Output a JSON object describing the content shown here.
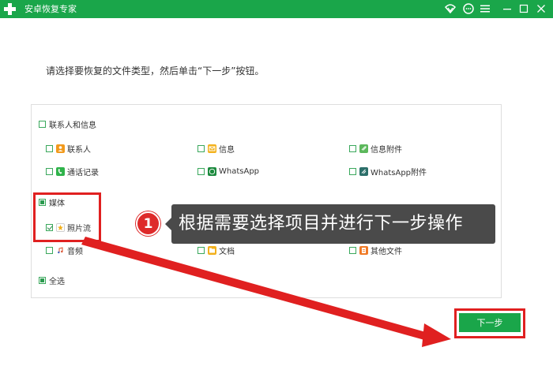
{
  "window": {
    "title": "安卓恢复专家",
    "icons": [
      "plus-logo-icon",
      "wifi-icon",
      "chat-icon",
      "menu-icon",
      "minimize-icon",
      "maximize-icon",
      "close-icon"
    ]
  },
  "instruction": "请选择要恢复的文件类型，然后单击“下一步”按钮。",
  "groups": {
    "contacts": {
      "label": "联系人和信息",
      "items": {
        "contacts": "联系人",
        "messages": "信息",
        "message_attachments": "信息附件",
        "call_log": "通话记录",
        "whatsapp": "WhatsApp",
        "whatsapp_attachments": "WhatsApp附件"
      }
    },
    "media": {
      "label": "媒体",
      "items": {
        "photo_stream": "照片流",
        "audio": "音频",
        "documents": "文档",
        "other_files": "其他文件"
      }
    },
    "select_all": "全选"
  },
  "annotation": {
    "step": "1",
    "tip": "根据需要选择项目并进行下一步操作"
  },
  "buttons": {
    "next": "下一步"
  },
  "colors": {
    "brand_green": "#1aa64a",
    "highlight_red": "#e02020",
    "tooltip_bg": "#4a4a4a"
  }
}
